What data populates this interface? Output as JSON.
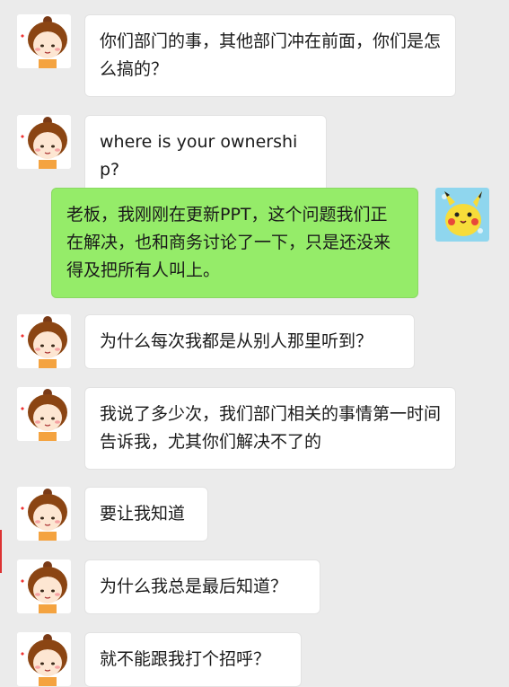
{
  "colors": {
    "background": "#ebebeb",
    "incoming_bubble": "#ffffff",
    "outgoing_bubble": "#95ec69"
  },
  "avatars": {
    "sender": "cartoon-girl-avatar",
    "me": "pikachu-avatar"
  },
  "messages": [
    {
      "from": "sender",
      "text": "你们部门的事，其他部门冲在前面，你们是怎么搞的？"
    },
    {
      "from": "sender",
      "text": "where is your ownership?"
    },
    {
      "from": "me",
      "text": "老板，我刚刚在更新PPT，这个问题我们正在解决，也和商务讨论了一下，只是还没来得及把所有人叫上。"
    },
    {
      "from": "sender",
      "text": "为什么每次我都是从别人那里听到？"
    },
    {
      "from": "sender",
      "text": "我说了多少次，我们部门相关的事情第一时间告诉我，尤其你们解决不了的"
    },
    {
      "from": "sender",
      "text": "要让我知道"
    },
    {
      "from": "sender",
      "text": "为什么我总是最后知道？"
    },
    {
      "from": "sender",
      "text": "就不能跟我打个招呼？"
    }
  ]
}
